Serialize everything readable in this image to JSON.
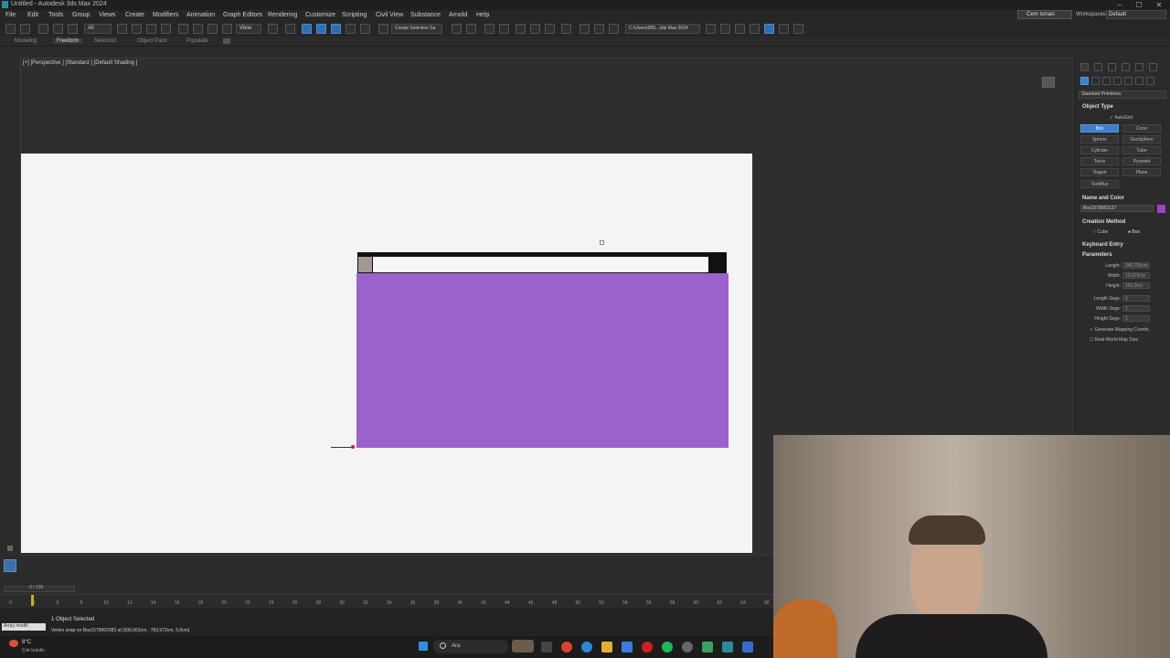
{
  "window": {
    "title": "Untitled - Autodesk 3ds Max 2024",
    "controls": [
      "–",
      "☐",
      "✕"
    ]
  },
  "menu": [
    "File",
    "Edit",
    "Tools",
    "Group",
    "Views",
    "Create",
    "Modifiers",
    "Animation",
    "Graph Editors",
    "Rendering",
    "Customize",
    "Scripting",
    "Civil View",
    "Substance",
    "Arnold",
    "Help"
  ],
  "account": {
    "user": "Cem Isman",
    "workspaces_label": "Workspaces:",
    "workspace": "Default"
  },
  "toolbar": {
    "filter": "All",
    "view": "View",
    "selection_set": "Create Selection Se",
    "path": "C:\\Users\\905...3ds Max 2024"
  },
  "ribbon": {
    "tabs": [
      "Modeling",
      "Freeform",
      "Selection",
      "Object Paint",
      "Populate"
    ],
    "active": "Freeform"
  },
  "viewport": {
    "label": "[+] [Perspective ] [Standard ] [Default Shading ]"
  },
  "command_panel": {
    "dropdown": "Standard Primitives",
    "object_type": {
      "title": "Object Type",
      "autogrid": "AutoGrid",
      "buttons": [
        "Box",
        "Cone",
        "Sphere",
        "GeoSphere",
        "Cylinder",
        "Tube",
        "Torus",
        "Pyramid",
        "Teapot",
        "Plane",
        "TextPlus"
      ],
      "active": "Box"
    },
    "name_and_color": {
      "title": "Name and Color",
      "name": "Box1578962127",
      "color": "#a33fc7"
    },
    "creation_method": {
      "title": "Creation Method",
      "options": [
        "Cube",
        "Box"
      ],
      "selected": "Box"
    },
    "keyboard_entry": {
      "title": "Keyboard Entry"
    },
    "parameters": {
      "title": "Parameters",
      "fields": [
        {
          "label": "Length:",
          "value": "340,756cm"
        },
        {
          "label": "Width:",
          "value": "10,879cm"
        },
        {
          "label": "Height:",
          "value": "160,0cm"
        }
      ],
      "segs": [
        {
          "label": "Length Segs:",
          "value": "1"
        },
        {
          "label": "Width Segs:",
          "value": "1"
        },
        {
          "label": "Height Segs:",
          "value": "1"
        }
      ],
      "generate_mapping": "Generate Mapping Coords.",
      "real_world": "Real-World Map Size"
    }
  },
  "timeline": {
    "frame_display": "0 / 100",
    "ticks": [
      "0",
      "2",
      "6",
      "8",
      "10",
      "12",
      "14",
      "16",
      "18",
      "20",
      "22",
      "24",
      "26",
      "28",
      "30",
      "32",
      "34",
      "36",
      "38",
      "40",
      "42",
      "44",
      "46",
      "48",
      "50",
      "52",
      "54",
      "56",
      "58",
      "60",
      "62",
      "64",
      "66"
    ]
  },
  "status": {
    "script_box": "Array modifi",
    "selected": "1 Object Selected",
    "prompt": "Vertex snap on Box1578962083 at [308,663cm, -763,972cm, 5,0cm]"
  },
  "taskbar": {
    "weather_temp": "8°C",
    "weather_desc": "Çok bulutlu",
    "search": "Ara"
  },
  "colors": {
    "purple_box": "#9c62cc",
    "accent": "#3d7fcf"
  }
}
